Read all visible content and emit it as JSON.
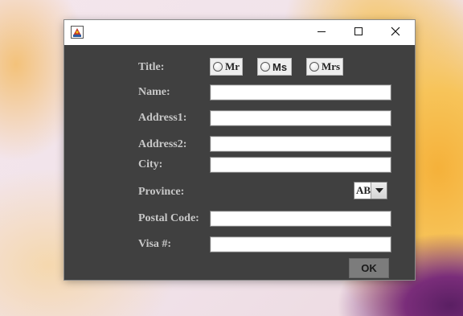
{
  "window": {
    "icon": "java-app-icon",
    "controls": [
      "minimize-icon",
      "maximize-icon",
      "close-icon"
    ]
  },
  "form": {
    "title_label": "Title:",
    "title_options": [
      {
        "label": "Mr",
        "selected": false
      },
      {
        "label": "Ms",
        "selected": false
      },
      {
        "label": "Mrs",
        "selected": false
      }
    ],
    "name_label": "Name:",
    "name_value": "",
    "address1_label": "Address1:",
    "address1_value": "",
    "address2_label": "Address2:",
    "address2_value": "",
    "city_label": "City:",
    "city_value": "",
    "province_label": "Province:",
    "province_value": "AB",
    "postal_label": "Postal Code:",
    "postal_value": "",
    "visa_label": "Visa #:",
    "visa_value": "",
    "ok_label": "OK"
  },
  "colors": {
    "dialog_bg": "#404040",
    "label_text": "#c8c8c8",
    "titlebar_bg": "#ffffff",
    "ok_button_bg": "#7c7c7c"
  }
}
